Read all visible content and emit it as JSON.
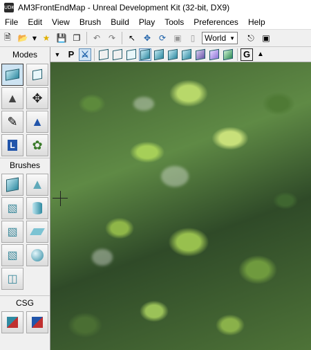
{
  "window": {
    "title": "AM3FrontEndMap - Unreal Development Kit (32-bit, DX9)",
    "icon": "UDK"
  },
  "menu": [
    "File",
    "Edit",
    "View",
    "Brush",
    "Build",
    "Play",
    "Tools",
    "Preferences",
    "Help"
  ],
  "toolbar": {
    "world_select": "World"
  },
  "left_panel": {
    "modes_label": "Modes",
    "brushes_label": "Brushes",
    "csg_label": "CSG"
  },
  "viewport_toolbar": {
    "perspective_label": "P",
    "game_label": "G"
  },
  "icons": {
    "mode_tools": [
      "camera-mode-icon",
      "geometry-mode-icon",
      "terrain-mode-icon",
      "transform-gizmo-icon",
      "texture-paint-icon",
      "mesh-paint-icon",
      "landscape-mode-icon",
      "foliage-mode-icon"
    ],
    "brush_tools": [
      "cube-brush-icon",
      "cone-brush-icon",
      "curved-stair-brush-icon",
      "cylinder-brush-icon",
      "linear-stair-brush-icon",
      "sheet-brush-icon",
      "spiral-stair-brush-icon",
      "sphere-brush-icon",
      "volumetric-brush-icon"
    ]
  },
  "colors": {
    "accent": "#3399ff",
    "panel": "#f0f0f0",
    "cube": "#2f8aa1"
  }
}
